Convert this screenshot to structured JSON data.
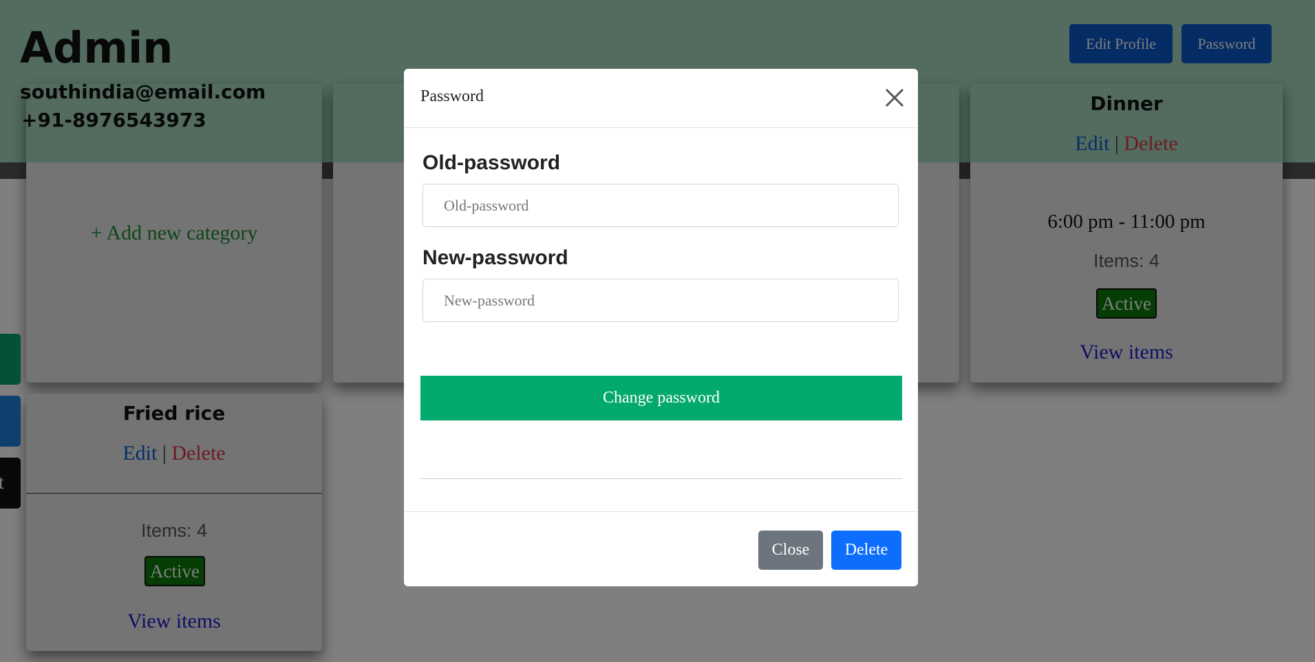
{
  "header": {
    "title": "Admin",
    "email": "southindia@email.com",
    "phone": "+91-8976543973",
    "edit_profile_label": "Edit Profile",
    "password_label": "Password"
  },
  "add_category": {
    "label": "+ Add new category"
  },
  "cards": [
    {
      "title": "Dinner",
      "edit_label": "Edit",
      "separator": "|",
      "delete_label": "Delete",
      "time": "6:00 pm - 11:00 pm",
      "items": "Items: 4",
      "status": "Active",
      "view_label": "View items"
    },
    {
      "title": "Fried rice",
      "edit_label": "Edit",
      "separator": "|",
      "delete_label": "Delete",
      "items": "Items: 4",
      "status": "Active",
      "view_label": "View items"
    }
  ],
  "side_tab_text": "t",
  "modal": {
    "title": "Password",
    "old_label": "Old-password",
    "old_placeholder": "Old-password",
    "old_value": "",
    "new_label": "New-password",
    "new_placeholder": "New-password",
    "new_value": "",
    "change_label": "Change password",
    "close_label": "Close",
    "delete_label": "Delete"
  },
  "colors": {
    "header_bg": "#a6d9be",
    "primary": "#0d6efd",
    "success": "#04aa6d",
    "secondary": "#6c757d",
    "danger": "#dc3545",
    "active_badge": "#0a7a0a"
  }
}
